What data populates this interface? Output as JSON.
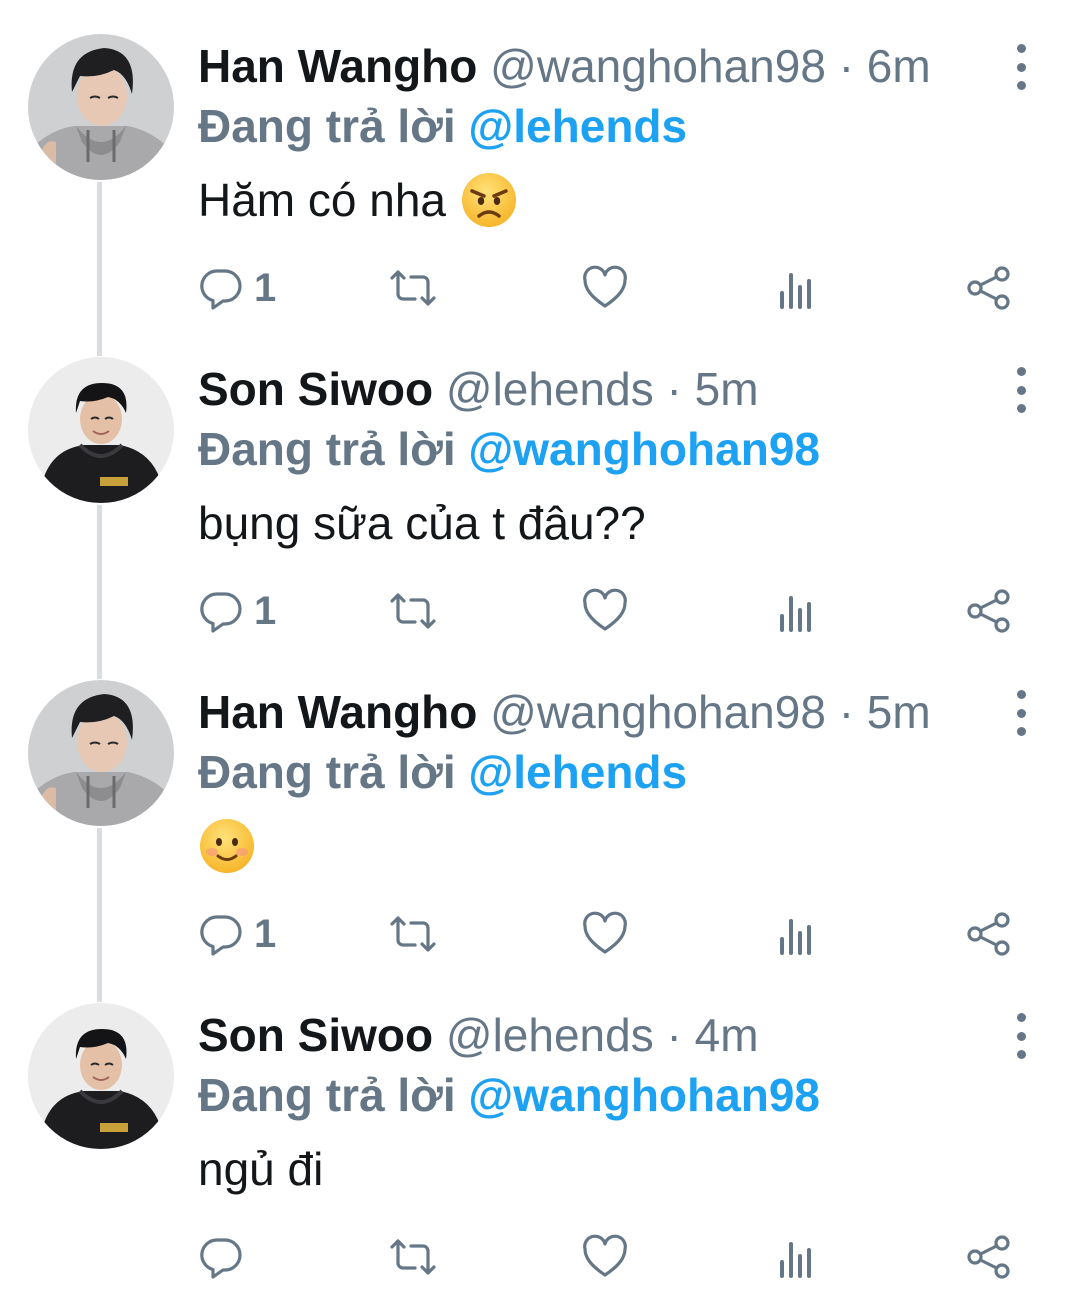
{
  "tweets": [
    {
      "name": "Han Wangho",
      "handle": "@wanghohan98",
      "separator": "·",
      "time": "6m",
      "reply_prefix": "Đang trả lời",
      "reply_to": "@lehends",
      "text": "Hăm có nha",
      "emoji": "angry-face",
      "reply_count": "1",
      "avatar": "person-grey-hoodie"
    },
    {
      "name": "Son Siwoo",
      "handle": "@lehends",
      "separator": "·",
      "time": "5m",
      "reply_prefix": "Đang trả lời",
      "reply_to": "@wanghohan98",
      "text": "bụng sữa của t đâu??",
      "emoji": "",
      "reply_count": "1",
      "avatar": "person-black-hoodie"
    },
    {
      "name": "Han Wangho",
      "handle": "@wanghohan98",
      "separator": "·",
      "time": "5m",
      "reply_prefix": "Đang trả lời",
      "reply_to": "@lehends",
      "text": "",
      "emoji": "smiling-face",
      "reply_count": "1",
      "avatar": "person-grey-hoodie"
    },
    {
      "name": "Son Siwoo",
      "handle": "@lehends",
      "separator": "·",
      "time": "4m",
      "reply_prefix": "Đang trả lời",
      "reply_to": "@wanghohan98",
      "text": "ngủ đi",
      "emoji": "",
      "reply_count": "",
      "avatar": "person-black-hoodie"
    }
  ],
  "icons": {
    "reply": "reply-icon",
    "retweet": "retweet-icon",
    "like": "heart-icon",
    "stats": "analytics-icon",
    "share": "share-icon",
    "more": "more-icon"
  },
  "colors": {
    "name": "#14171a",
    "muted": "#657786",
    "link": "#1da1f2",
    "thread_line": "#d9dde1",
    "icon": "#657786"
  }
}
